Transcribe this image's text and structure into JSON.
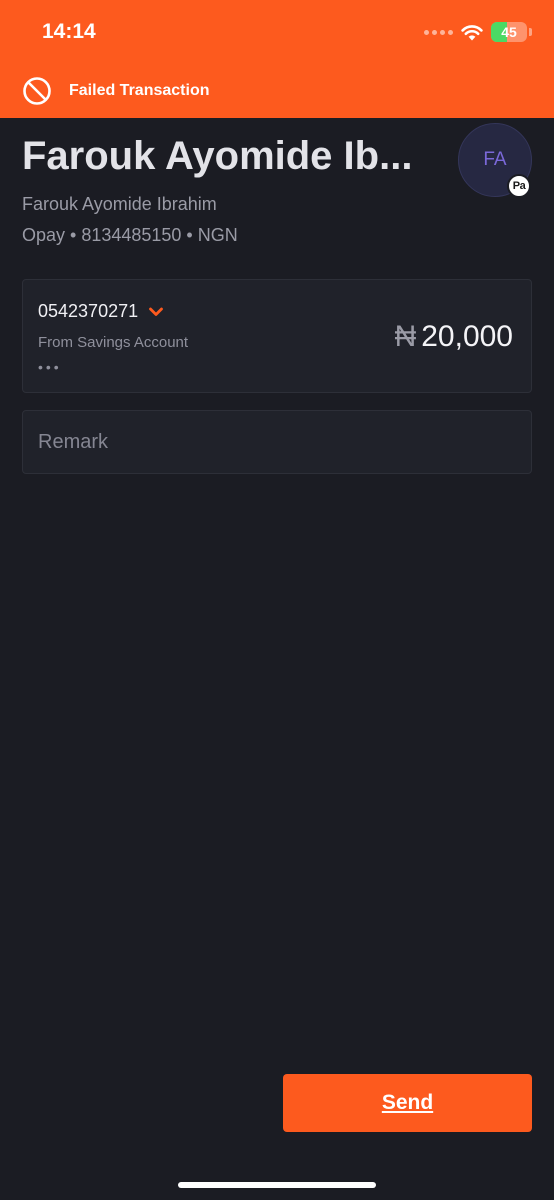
{
  "status_bar": {
    "time": "14:14",
    "battery": "45",
    "battery_level": 0.45
  },
  "banner": {
    "icon": "prohibited-circle-icon",
    "text": "Failed Transaction"
  },
  "recipient": {
    "title": "Farouk Ayomide Ib...",
    "full_name": "Farouk Ayomide Ibrahim",
    "details": "Opay • 8134485150 • NGN",
    "avatar_initials": "FA",
    "bank_badge": "Pa"
  },
  "account": {
    "number": "0542370271",
    "source": "From Savings Account",
    "more": "•••",
    "currency_symbol": "₦",
    "amount": "20,000"
  },
  "remark": {
    "placeholder": "Remark",
    "value": ""
  },
  "actions": {
    "send_label": "Send"
  },
  "colors": {
    "accent": "#fd5a1e",
    "background": "#1b1c23",
    "card": "#20222a",
    "success": "#4cd964"
  }
}
